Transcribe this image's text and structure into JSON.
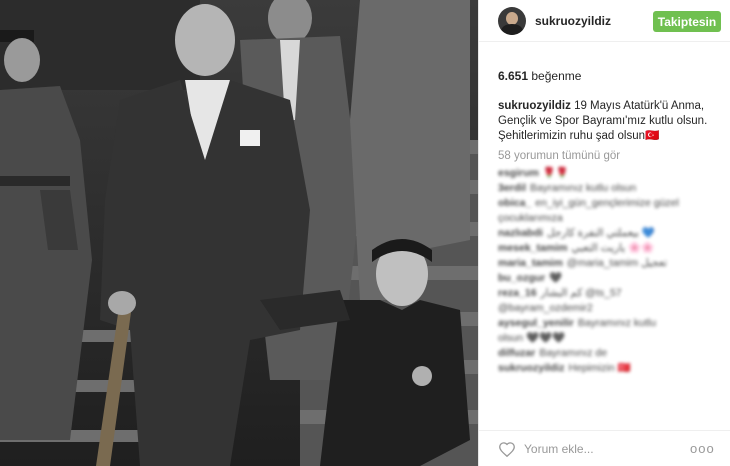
{
  "photo": {
    "alt_icon": "historic-photo"
  },
  "header": {
    "username": "sukruozyildiz",
    "follow_label": "Takiptesin",
    "follow_color": "#70c050"
  },
  "likes": {
    "count": "6.651",
    "label": "beğenme"
  },
  "caption": {
    "user": "sukruozyildiz",
    "text": "19 Mayıs Atatürk'ü Anma, Gençlik ve Spor Bayramı'mız kutlu olsun. Şehitlerimizin ruhu şad olsun🇹🇷"
  },
  "comments_link": "58 yorumun tümünü gör",
  "comments": [
    {
      "user": "esgirum",
      "text": "🌹🌹"
    },
    {
      "user": "3erdil",
      "text": "Bayramınız kutlu olsun"
    },
    {
      "user": "obica_",
      "text": "en_iyi_gün_gençlerimize güzel"
    },
    {
      "user": "",
      "text": "çocuklarımıza"
    },
    {
      "user": "nazlıabdi",
      "text": "بيعملتي النفرة كارجل 💙"
    },
    {
      "user": "mesek_tamim",
      "text": "ياريت التعبي 🌸🌸"
    },
    {
      "user": "maria_tamim",
      "text": "@maria_tamim تعجيل"
    },
    {
      "user": "bu_ozgur",
      "text": "🖤"
    },
    {
      "user": "reza_16",
      "text": "كم البشار @ts_57"
    },
    {
      "user": "",
      "text": "@bayram_ozdemir2"
    },
    {
      "user": "aysegul_yenilir",
      "text": "Bayramınız kutlu"
    },
    {
      "user": "",
      "text": "olsun 🖤🖤🖤"
    },
    {
      "user": "dilfuzar",
      "text": "Bayramınız de"
    },
    {
      "user": "sukruozyildiz",
      "text": "Hepimizin 🇹🇷"
    }
  ],
  "footer": {
    "comment_placeholder": "Yorum ekle...",
    "more_label": "ooo"
  }
}
